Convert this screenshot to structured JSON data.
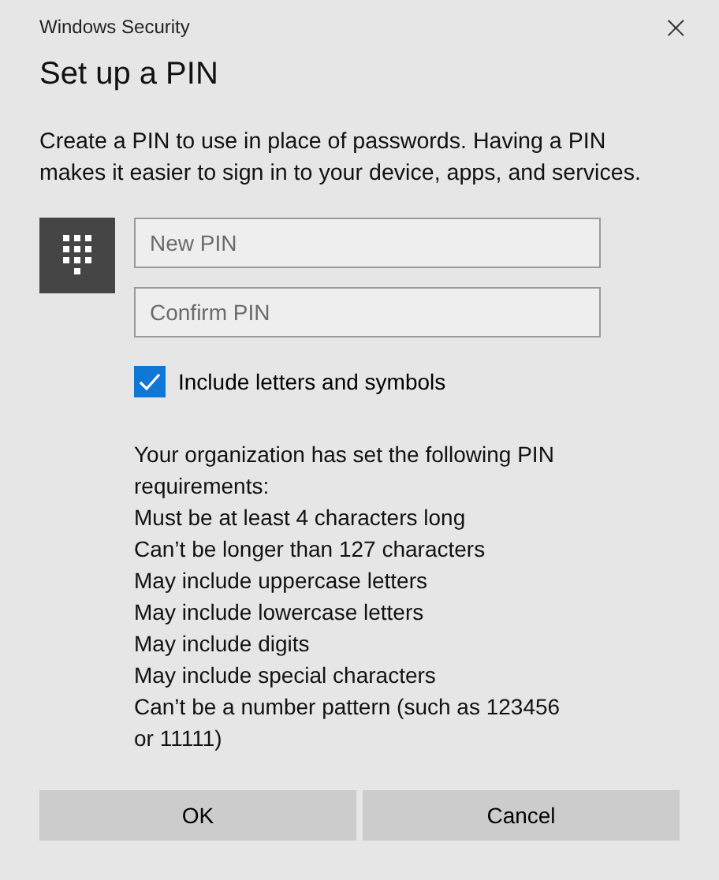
{
  "window": {
    "title": "Windows Security",
    "close": "×"
  },
  "heading": "Set up a PIN",
  "description": "Create a PIN to use in place of passwords. Having a PIN makes it easier to sign in to your device, apps, and services.",
  "fields": [
    {
      "placeholder": "New PIN"
    },
    {
      "placeholder": "Confirm PIN"
    }
  ],
  "checkbox": {
    "label": "Include letters and symbols",
    "checked": true
  },
  "requirements": {
    "intro": "Your organization has set the following PIN requirements:",
    "items": [
      "Must be at least 4 characters long",
      "Can’t be longer than 127 characters",
      "May include uppercase letters",
      "May include lowercase letters",
      "May include digits",
      "May include special characters",
      "Can’t be a number pattern (such as 123456 or 11111)"
    ]
  },
  "buttons": [
    "OK",
    "Cancel"
  ]
}
